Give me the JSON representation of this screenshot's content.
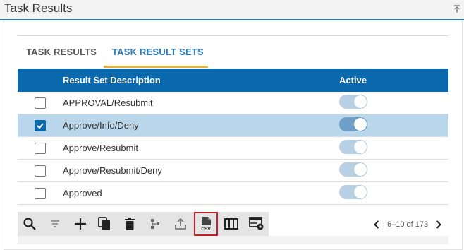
{
  "header": {
    "title": "Task Results"
  },
  "tabs": [
    {
      "label": "TASK RESULTS",
      "active": false
    },
    {
      "label": "TASK RESULT SETS",
      "active": true
    }
  ],
  "table": {
    "columns": [
      "Result Set Description",
      "Active"
    ],
    "rows": [
      {
        "description": "APPROVAL/Resubmit",
        "checked": false,
        "active": true
      },
      {
        "description": "Approve/Info/Deny",
        "checked": true,
        "active": true
      },
      {
        "description": "Approve/Resubmit",
        "checked": false,
        "active": true
      },
      {
        "description": "Approve/Resubmit/Deny",
        "checked": false,
        "active": true
      },
      {
        "description": "Approved",
        "checked": false,
        "active": true
      }
    ]
  },
  "toolbar": {
    "buttons": [
      "search-icon",
      "filter-icon",
      "add-icon",
      "copy-icon",
      "delete-icon",
      "hierarchy-icon",
      "export-icon",
      "csv-icon",
      "columns-icon",
      "settings-grid-icon"
    ],
    "csv_label": "CSV"
  },
  "pager": {
    "info": "6–10 of 173"
  },
  "colors": {
    "header_bg": "#0a68ad",
    "tab_active": "#2a7ab8",
    "tab_underline": "#e8b23a",
    "selected_row": "#b9d6ea",
    "toggle_on": "#b7d0e4",
    "highlight_border": "#c0202a"
  }
}
